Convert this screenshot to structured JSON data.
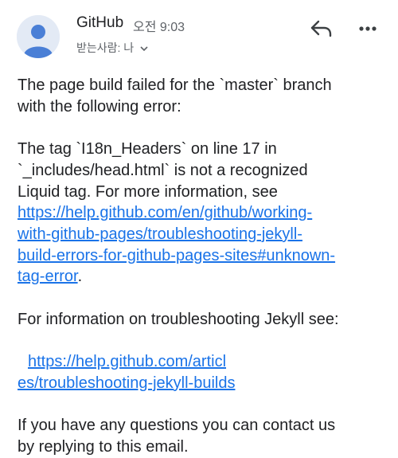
{
  "header": {
    "sender": "GitHub",
    "time": "오전 9:03",
    "recipient_label": "받는사람: 나"
  },
  "icons": {
    "avatar": "person-avatar-icon",
    "reply": "reply-arrow-icon",
    "more": "more-horizontal-icon",
    "chevron": "chevron-down-icon"
  },
  "colors": {
    "link": "#1a73e8",
    "avatar_bg": "#e3eaf5",
    "avatar_fg": "#4a7fd6"
  },
  "body": {
    "p1_line1": "The page build failed for the `master` branch",
    "p1_line2": "with the following error:",
    "p2_line1": "The tag `I18n_Headers` on line 17 in",
    "p2_line2": "`_includes/head.html` is not a recognized",
    "p2_line3": "Liquid tag. For more information, see",
    "link1_line1": "https://help.github.com/en/github/working-",
    "link1_line2": "with-github-pages/troubleshooting-jekyll-",
    "link1_line3": "build-errors-for-github-pages-sites#unknown-",
    "link1_line4": "tag-error",
    "link1_after": ".",
    "p3": "For information on troubleshooting Jekyll see:",
    "link2_line1": "https://help.github.com/articl",
    "link2_line2": "es/troubleshooting-jekyll-builds",
    "p4_line1": "If you have any questions you can contact us",
    "p4_line2": "by replying to this email."
  }
}
